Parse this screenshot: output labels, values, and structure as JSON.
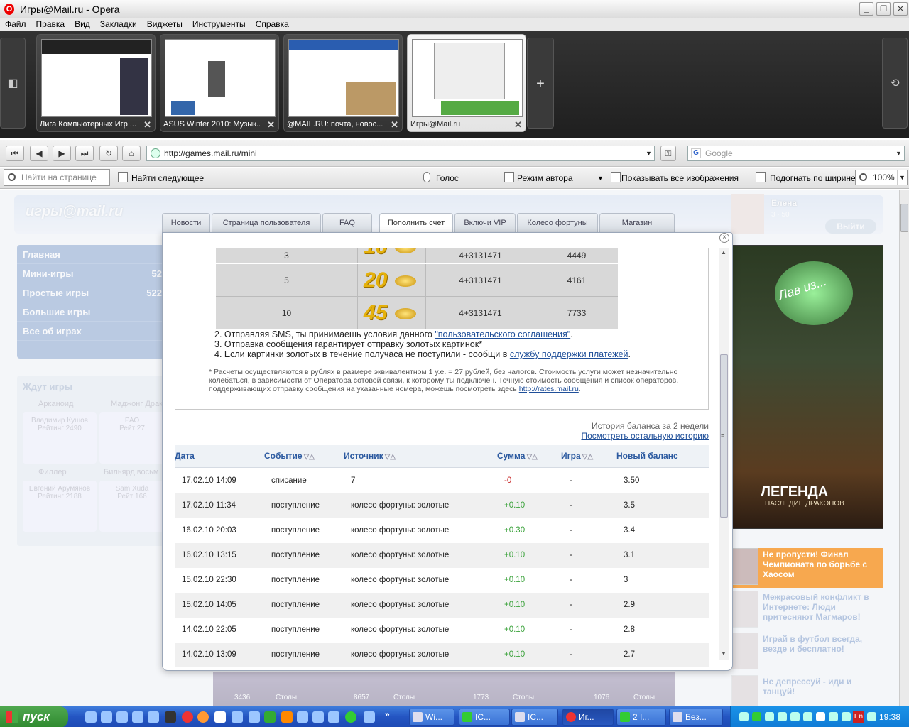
{
  "window": {
    "title": "Игры@Mail.ru - Opera",
    "min": "_",
    "max": "❐",
    "close": "✕"
  },
  "menu": [
    "Файл",
    "Правка",
    "Вид",
    "Закладки",
    "Виджеты",
    "Инструменты",
    "Справка"
  ],
  "tabs": [
    {
      "label": "Лига Компьютерных Игр ...",
      "close": "✕"
    },
    {
      "label": "ASUS Winter 2010: Музык...",
      "close": "✕"
    },
    {
      "label": "@MAIL.RU: почта, новос...",
      "close": "✕"
    },
    {
      "label": "Игры@Mail.ru",
      "close": "✕"
    }
  ],
  "add_tab": "+",
  "address": {
    "url": "http://games.mail.ru/mini",
    "search_placeholder": "Google",
    "search_engine": "G"
  },
  "nav_buttons": {
    "first": "⏮",
    "back": "◀",
    "forward": "▶",
    "fast_forward": "⏭",
    "reload": "↻",
    "home": "⌂"
  },
  "findbar": {
    "placeholder": "Найти на странице",
    "find_next": "Найти следующее",
    "voice": "Голос",
    "author_mode": "Режим автора",
    "show_images": "Показывать все изображения",
    "fit_width": "Подогнать по ширине",
    "zoom": "100%"
  },
  "site": {
    "logo": "игры@mail.ru",
    "user": {
      "name": "Елена",
      "stats": "3 · 50",
      "logout": "Выйти"
    },
    "left_nav": [
      {
        "label": "Главная",
        "count": ""
      },
      {
        "label": "Мини-игры",
        "count": "52"
      },
      {
        "label": "Простые игры",
        "count": "522"
      },
      {
        "label": "Большие игры",
        "count": ""
      },
      {
        "label": "Все об играх",
        "count": ""
      }
    ],
    "waiting": {
      "title": "Ждут игры",
      "games": [
        "Арканоид",
        "Маджонг Драк",
        "Филлер",
        "Бильярд восьм"
      ],
      "players": [
        {
          "name": "Владимир Кушов",
          "rating": "Рейтинг 2490"
        },
        {
          "name": "РАО",
          "rating": "Рейт 27"
        },
        {
          "name": "Евгений Арумянов",
          "rating": "Рейтинг 2188"
        },
        {
          "name": "Sam Xuda",
          "rating": "Рейт 166"
        }
      ]
    },
    "promo": {
      "heart_text": "Лав из...",
      "legend": "ЛЕГЕНДА",
      "legend_sub": "НАСЛЕДИЕ ДРАКОНОВ"
    },
    "news": [
      "Не пропусти! Финал Чемпионата по борьбе с Хаосом",
      "Межрасовый конфликт в Интернете: Люди притесняют Магмаров!",
      "Играй в футбол всегда, везде и бесплатно!",
      "Не депрессуй - иди и танцуй!"
    ],
    "games_bottom": [
      "3436",
      "Столы",
      "8657",
      "Столы",
      "1773",
      "Столы",
      "1076",
      "Столы"
    ]
  },
  "modal": {
    "tabs": [
      "Новости",
      "Страница пользователя",
      "FAQ",
      "Пополнить счет",
      "Включи VIP",
      "Колесо фортуны",
      "Магазин"
    ],
    "active_tab": 3,
    "close": "×",
    "sms_rows": [
      {
        "price": "3",
        "gold": "10",
        "number": "4+3131471",
        "code": "4449"
      },
      {
        "price": "5",
        "gold": "20",
        "number": "4+3131471",
        "code": "4161"
      },
      {
        "price": "10",
        "gold": "45",
        "number": "4+3131471",
        "code": "7733"
      }
    ],
    "rules": [
      {
        "num": "2.",
        "text": "Отправляя SMS, ты принимаешь условия данного ",
        "link": "\"пользовательского соглашения\"",
        "after": "."
      },
      {
        "num": "3.",
        "text": "Отправка сообщения гарантирует отправку золотых картинок*",
        "link": "",
        "after": ""
      },
      {
        "num": "4.",
        "text": "Если картинки золотых в течение получаса не поступили - сообщи в ",
        "link": "службу поддержки платежей",
        "after": "."
      }
    ],
    "footnote": "* Расчеты осуществляются в рублях в размере эквивалентном 1 у.е. = 27 рублей, без налогов. Стоимость услуги может незначительно колебаться, в зависимости от Оператора сотовой связи, к которому ты подключен. Точную стоимость сообщения и список операторов, поддерживающих отправку сообщения на указанные номера, можешь посмотреть здесь ",
    "footnote_link": "http://rates.mail.ru",
    "footnote_end": ".",
    "history_label": "История баланса за 2 недели",
    "history_link": "Посмотреть остальную историю",
    "history_headers": [
      "Дата",
      "Событие",
      "Источник",
      "Сумма",
      "Игра",
      "Новый баланс"
    ],
    "history": [
      {
        "date": "17.02.10 14:09",
        "event": "списание",
        "source": "7",
        "amount": "-0",
        "game": "-",
        "balance": "3.50"
      },
      {
        "date": "17.02.10 11:34",
        "event": "поступление",
        "source": "колесо фортуны: золотые",
        "amount": "+0.10",
        "game": "-",
        "balance": "3.5"
      },
      {
        "date": "16.02.10 20:03",
        "event": "поступление",
        "source": "колесо фортуны: золотые",
        "amount": "+0.30",
        "game": "-",
        "balance": "3.4"
      },
      {
        "date": "16.02.10 13:15",
        "event": "поступление",
        "source": "колесо фортуны: золотые",
        "amount": "+0.10",
        "game": "-",
        "balance": "3.1"
      },
      {
        "date": "15.02.10 22:30",
        "event": "поступление",
        "source": "колесо фортуны: золотые",
        "amount": "+0.10",
        "game": "-",
        "balance": "3"
      },
      {
        "date": "15.02.10 14:05",
        "event": "поступление",
        "source": "колесо фортуны: золотые",
        "amount": "+0.10",
        "game": "-",
        "balance": "2.9"
      },
      {
        "date": "14.02.10 22:05",
        "event": "поступление",
        "source": "колесо фортуны: золотые",
        "amount": "+0.10",
        "game": "-",
        "balance": "2.8"
      },
      {
        "date": "14.02.10 13:09",
        "event": "поступление",
        "source": "колесо фортуны: золотые",
        "amount": "+0.10",
        "game": "-",
        "balance": "2.7"
      }
    ]
  },
  "taskbar": {
    "start": "пуск",
    "buttons": [
      "Wi...",
      "IC...",
      "IC...",
      "Иг...",
      "2 I...",
      "Без..."
    ],
    "lang": "En",
    "clock": "19:38"
  },
  "colors": {
    "positive": "#3aa23a",
    "negative": "#c92a2a",
    "link": "#1f4f99",
    "header_text": "#2c5aa0"
  }
}
